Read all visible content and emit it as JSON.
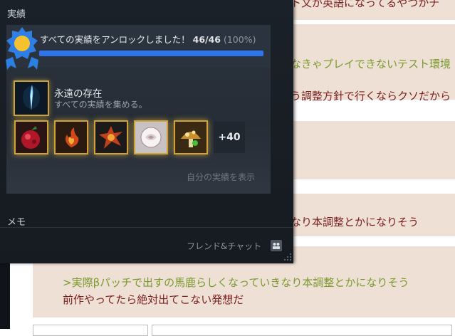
{
  "background_page": {
    "lines": [
      {
        "text": "ト文が英語になってるやつかチ",
        "kind": "plain"
      },
      {
        "text": "なきゃプレイできないテスト環境",
        "kind": "quote"
      },
      {
        "text": "う調整方針で行くならクソだから",
        "kind": "plain"
      },
      {
        "text": "なり本調整とかになりそう",
        "kind": "plain"
      }
    ],
    "bottom_post": {
      "quote": ">実際βパッチで出すの馬鹿らしくなっていきなり本調整とかになりそう",
      "reply": "前作やってたら絶対出てこない発想だ"
    }
  },
  "overlay": {
    "achievements_heading": "実績",
    "unlock": {
      "message": "すべての実績をアンロックしました！",
      "count": "46/46",
      "percent_text": "(100%)",
      "progress": 1.0
    },
    "featured": {
      "title": "永遠の存在",
      "description": "すべての実績を集める。",
      "icon": "blue-flame-icon"
    },
    "thumbnails": [
      {
        "icon": "red-berry-icon"
      },
      {
        "icon": "fire-sprite-icon"
      },
      {
        "icon": "explosion-icon"
      },
      {
        "icon": "white-rose-icon"
      },
      {
        "icon": "spotted-mushroom-icon"
      }
    ],
    "more_badge": "+40",
    "show_mine_link": "自分の実績を表示",
    "memo_heading": "メモ",
    "friends_chat": "フレンド&チャット"
  },
  "colors": {
    "accent_blue": "#2f74ea",
    "gold_border": "#cfa33a",
    "quote_green": "#7a9a2e",
    "text_red": "#7a2020"
  }
}
